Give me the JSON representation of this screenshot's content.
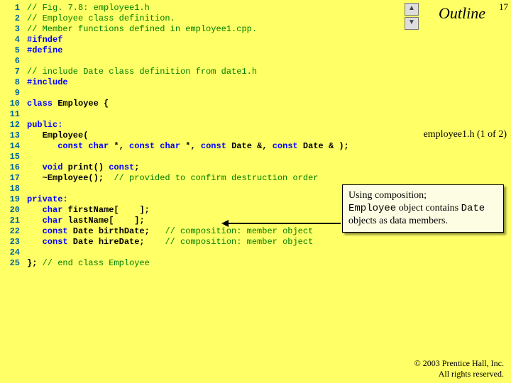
{
  "slide": {
    "outline_label": "Outline",
    "number": "17",
    "file_label": "employee1.h (1 of 2)"
  },
  "nav": {
    "up": "▲",
    "down": "▼"
  },
  "callout": {
    "l1a": "Using composition;",
    "l2a": "Employee",
    "l2b": " object contains ",
    "l3a": "Date",
    "l3b": " objects as data members."
  },
  "copyright": {
    "line1": "© 2003 Prentice Hall, Inc.",
    "line2": "All rights reserved."
  },
  "code": {
    "l1": "// Fig. 7.8: employee1.h",
    "l2": "// Employee class definition.",
    "l3": "// Member functions defined in employee1.cpp.",
    "l4": "#ifndef",
    "l5": "#define",
    "l6": "",
    "l7": "// include Date class definition from date1.h",
    "l8": "#include",
    "l9": "",
    "l10_a": "class",
    "l10_b": " Employee {",
    "l11": "",
    "l12": "public:",
    "l13": "   Employee(",
    "l14_a": "      const",
    "l14_b": " char",
    "l14_c": " *, ",
    "l14_d": "const",
    "l14_e": " char",
    "l14_f": " *, ",
    "l14_g": "const",
    "l14_h": " Date &, ",
    "l14_i": "const",
    "l14_j": " Date & );",
    "l15": "",
    "l16_a": "   void",
    "l16_b": " print() ",
    "l16_c": "const",
    "l16_d": ";",
    "l17_a": "   ~Employee();  ",
    "l17_b": "// provided to confirm destruction order",
    "l18": "",
    "l19": "private:",
    "l20_a": "   char",
    "l20_b": " firstName[    ];",
    "l21_a": "   char",
    "l21_b": " lastName[    ];",
    "l22_a": "   const",
    "l22_b": " Date birthDate;   ",
    "l22_c": "// composition: member object",
    "l23_a": "   const",
    "l23_b": " Date hireDate;    ",
    "l23_c": "// composition: member object",
    "l24": "",
    "l25_a": "}; ",
    "l25_b": "// end class Employee"
  }
}
